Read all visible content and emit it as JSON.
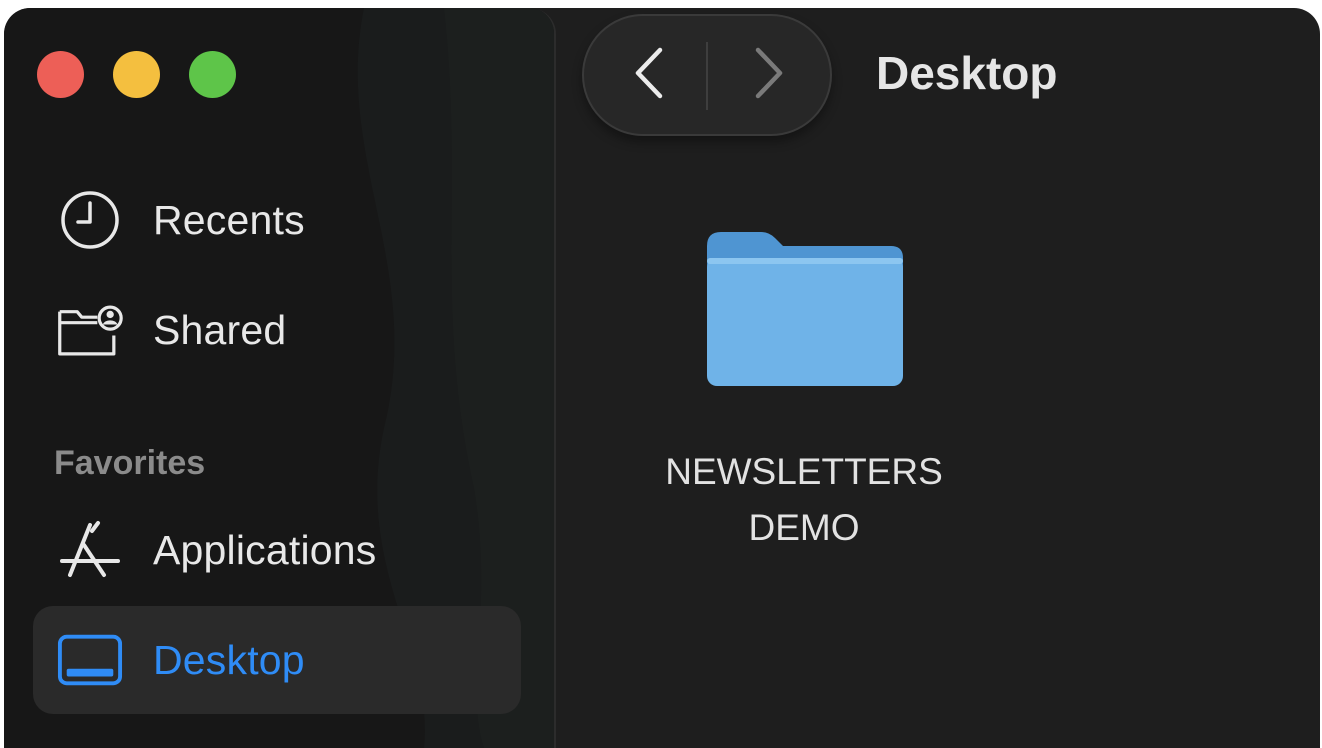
{
  "window": {
    "title": "Desktop",
    "controls": {
      "close_color": "#ed5f57",
      "minimize_color": "#f4bf3f",
      "zoom_color": "#5ec549"
    }
  },
  "sidebar": {
    "items": [
      {
        "label": "Recents",
        "icon": "clock-icon"
      },
      {
        "label": "Shared",
        "icon": "shared-folder-icon"
      }
    ],
    "favorites": {
      "header": "Favorites",
      "items": [
        {
          "label": "Applications",
          "icon": "applications-icon"
        },
        {
          "label": "Desktop",
          "icon": "desktop-icon",
          "selected": true
        }
      ]
    }
  },
  "toolbar": {
    "back_icon": "chevron-left-icon",
    "forward_icon": "chevron-right-icon"
  },
  "content": {
    "files": [
      {
        "name": "NEWSLETTERS DEMO",
        "icon": "folder-icon"
      }
    ]
  },
  "colors": {
    "accent": "#2f8cf6",
    "folder": "#6fb3e8"
  }
}
